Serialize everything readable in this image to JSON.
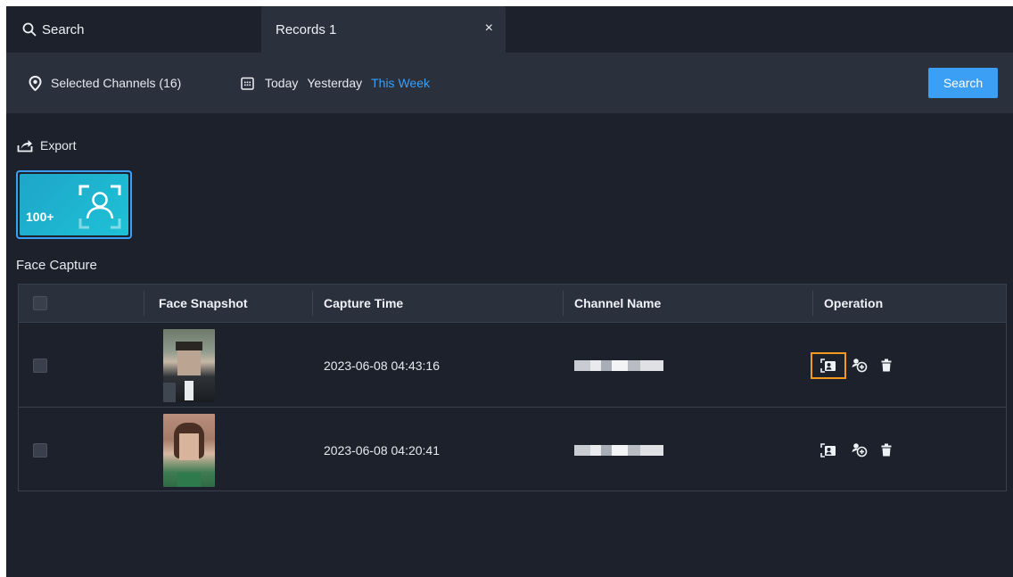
{
  "tabs": {
    "search_label": "Search",
    "records_label": "Records 1",
    "close_glyph": "×"
  },
  "filters": {
    "channels_label": "Selected Channels (16)",
    "dates": [
      {
        "label": "Today",
        "active": false
      },
      {
        "label": "Yesterday",
        "active": false
      },
      {
        "label": "This Week",
        "active": true
      }
    ],
    "search_button": "Search"
  },
  "toolbar": {
    "export_label": "Export"
  },
  "capture_card": {
    "count": "100+"
  },
  "section": {
    "title": "Face Capture"
  },
  "table": {
    "columns": [
      "Face Snapshot",
      "Capture Time",
      "Channel Name",
      "Operation"
    ],
    "rows": [
      {
        "capture_time": "2023-06-08 04:43:16",
        "channel_name_redacted": true
      },
      {
        "capture_time": "2023-06-08 04:20:41",
        "channel_name_redacted": true
      }
    ]
  },
  "icons": {
    "search": "magnifier-icon",
    "close": "close-icon",
    "location": "location-pin-icon",
    "calendar": "calendar-icon",
    "export": "export-icon",
    "face": "face-frame-icon",
    "face_search": "face-search-icon",
    "add_to_library": "add-person-icon",
    "delete": "trash-icon"
  },
  "colors": {
    "background": "#1c212b",
    "panel": "#2a303c",
    "accent": "#3a9ff5",
    "focus_outline": "#f39a1e",
    "card_gradient_start": "#1fa5c9",
    "card_gradient_end": "#1dc2d6"
  }
}
